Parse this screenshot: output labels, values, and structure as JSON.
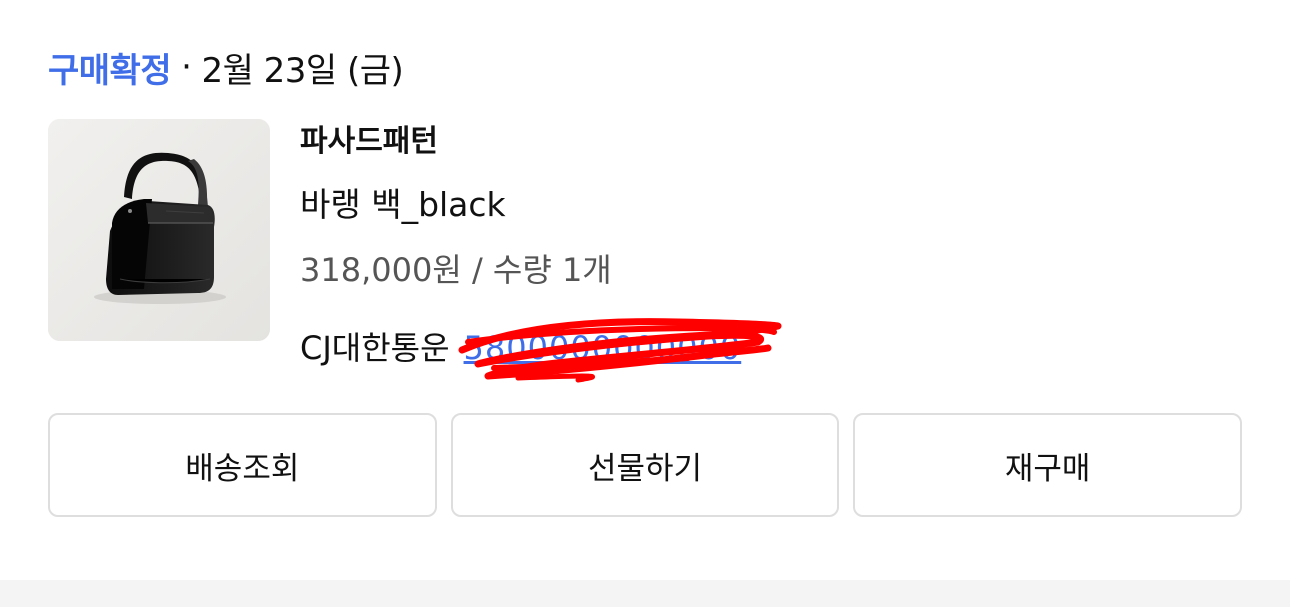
{
  "order": {
    "status": "구매확정",
    "separator": "·",
    "date": "2월 23일 (금)"
  },
  "product": {
    "image_icon": "black-handbag-photo",
    "brand": "파사드패턴",
    "name": "바랭 백_black",
    "price_line": "318,000원 / 수량 1개"
  },
  "shipping": {
    "carrier": "CJ대한통운",
    "tracking_number": "5800000000000"
  },
  "actions": {
    "track": "배송조회",
    "gift": "선물하기",
    "rebuy": "재구매"
  },
  "colors": {
    "accent": "#3f6ee8",
    "redaction": "#ff0000"
  }
}
